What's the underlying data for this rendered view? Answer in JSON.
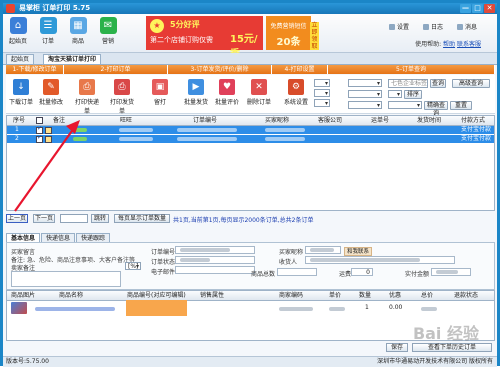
{
  "window": {
    "title": "易掌柜 订单打印 5.75",
    "controls": [
      "—",
      "□",
      "✕"
    ]
  },
  "appbar": {
    "buttons": [
      {
        "label": "起始页",
        "icon": "home-icon",
        "color": "#3b7fd8",
        "glyph": "⌂"
      },
      {
        "label": "订单",
        "icon": "order-icon",
        "color": "#2f9ad8",
        "glyph": "☰"
      },
      {
        "label": "商品",
        "icon": "product-icon",
        "color": "#5aa7e4",
        "glyph": "▦"
      },
      {
        "label": "营销",
        "icon": "marketing-icon",
        "color": "#2bb24a",
        "glyph": "✉"
      }
    ],
    "banner_promo": {
      "line1": "5分好评",
      "line2": "第二个店铺订购仅需",
      "price": "15元/季"
    },
    "banner_sms": {
      "line1": "免费营销短信",
      "line2": "20条",
      "tag": "立即领取"
    },
    "links": [
      "设置",
      "日志",
      "消息"
    ],
    "status_prefix": "使用帮助:",
    "status_link1": "帮助",
    "status_link2": "联系客服"
  },
  "doc_tabs": [
    "起始页",
    "淘宝天猫订单打印"
  ],
  "steps": [
    "1-下载/修改订单",
    "2-打印订单",
    "3-订单发货/评价/删除",
    "4-打印设置",
    "5-订单查询"
  ],
  "tools": [
    {
      "label": "下载订单",
      "icon": "download-icon",
      "color": "#2f7fd6",
      "glyph": "↓"
    },
    {
      "label": "批量修改",
      "icon": "batch-edit-icon",
      "color": "#e25a2a",
      "glyph": "✎"
    },
    {
      "label": "打印快递单",
      "icon": "print-express-icon",
      "color": "#e8784a",
      "glyph": "⎙"
    },
    {
      "label": "打印发货单",
      "icon": "print-ship-icon",
      "color": "#d94848",
      "glyph": "⎙"
    },
    {
      "label": "留打",
      "icon": "hold-print-icon",
      "color": "#e55a5a",
      "glyph": "▣"
    },
    {
      "label": "批量发货",
      "icon": "batch-ship-icon",
      "color": "#3f8fe0",
      "glyph": "▶"
    },
    {
      "label": "批量评价",
      "icon": "batch-review-icon",
      "color": "#e0405a",
      "glyph": "♥"
    },
    {
      "label": "删除订单",
      "icon": "delete-order-icon",
      "color": "#e05050",
      "glyph": "✕"
    },
    {
      "label": "系统设置",
      "icon": "settings-icon",
      "color": "#d84c2a",
      "glyph": "⚙"
    }
  ],
  "search": {
    "placeholder": "七色企业标签",
    "sort_btn": "排序",
    "query_btn": "查询",
    "clear_btn": "重置",
    "more_btn": "精确查询",
    "advanced_btn": "高级查询"
  },
  "grid": {
    "headers": [
      "序号",
      "",
      "备注",
      "",
      "旺旺",
      "订单编号",
      "买家昵称",
      "客服公司",
      "运单号",
      "发货时间",
      "付款方式"
    ],
    "rows": [
      {
        "no": "1",
        "pay": "支付宝付款"
      },
      {
        "no": "2",
        "pay": "支付宝付款"
      }
    ]
  },
  "pager": {
    "prev": "上一页",
    "next": "下一页",
    "jump": "跳转",
    "page_size": "每页显示订单数量",
    "info": "共1页,当前第1页,每页显示2000条订单,总共2条订单"
  },
  "detail_tabs": [
    "基本信息",
    "快递信息",
    "快递跟踪"
  ],
  "detail": {
    "buyer_msg": "买家留言",
    "remark_label": "备注:",
    "remark_value": "急、危险、商品注意事项、大客户备注等",
    "seller_note": "卖家备注",
    "order_no": "订单编号",
    "order_status": "订单状态",
    "email": "电子邮件",
    "buyer_id": "买家昵称",
    "chat": "和我联系",
    "receiver": "收货人",
    "total_qty": "商品总数",
    "postage": "运费",
    "postage_value": "0",
    "paid": "实付金额",
    "unit": "[%]"
  },
  "items": {
    "headers": [
      "商品图片",
      "商品名称",
      "商品编号(对应可编辑)",
      "销售属性",
      "商家编码",
      "单价",
      "数量",
      "优惠",
      "总价",
      "退款状态"
    ],
    "row": {
      "qty": "1",
      "discount": "0.00"
    }
  },
  "bottom": {
    "save": "保存",
    "check": "查看下单历史订单"
  },
  "status": {
    "left": "版本号:5.75.00",
    "right": "深圳市华通易动开发技术有限公司 版权所有"
  },
  "watermark": "Bai 经验"
}
